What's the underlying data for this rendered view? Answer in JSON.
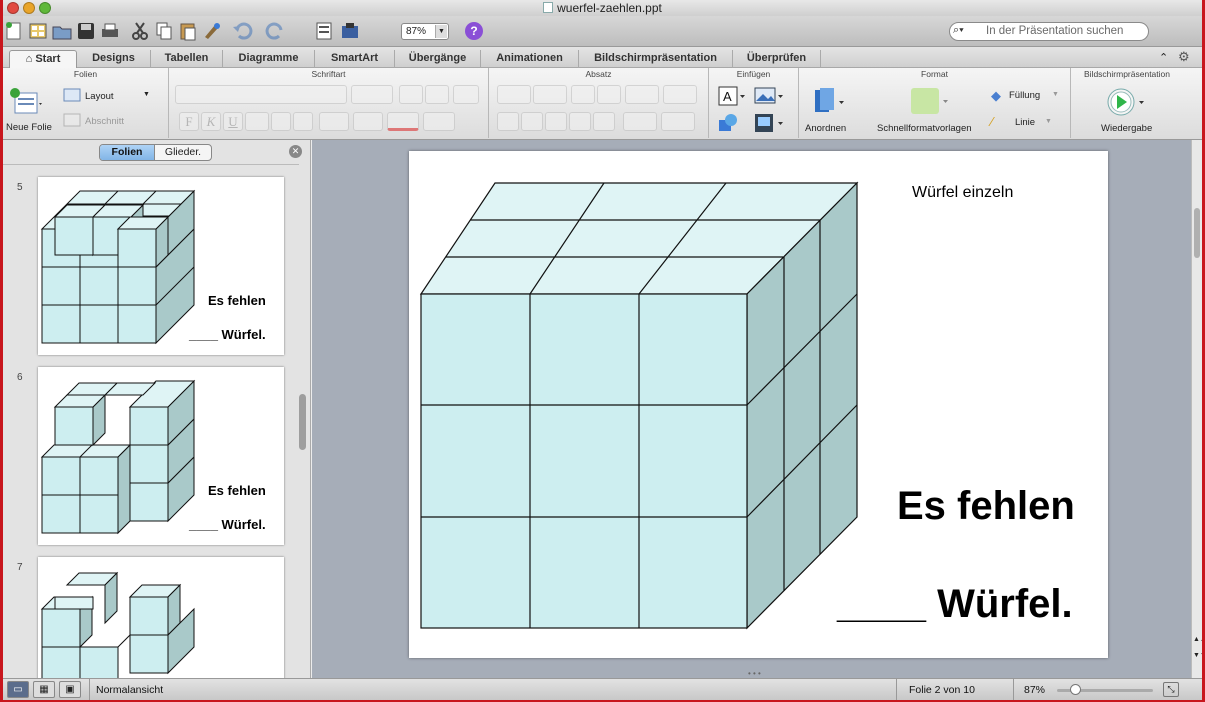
{
  "window": {
    "title": "wuerfel-zaehlen.ppt"
  },
  "toolbar": {
    "zoom": "87%",
    "help_label": "?"
  },
  "search": {
    "placeholder": "In der Präsentation suchen"
  },
  "tabs": [
    {
      "label": "Start",
      "icon": "home-icon"
    },
    {
      "label": "Designs"
    },
    {
      "label": "Tabellen"
    },
    {
      "label": "Diagramme"
    },
    {
      "label": "SmartArt"
    },
    {
      "label": "Übergänge"
    },
    {
      "label": "Animationen"
    },
    {
      "label": "Bildschirmpräsentation"
    },
    {
      "label": "Überprüfen"
    }
  ],
  "ribbon": {
    "folien": {
      "title": "Folien",
      "new_slide": "Neue Folie",
      "layout": "Layout",
      "section": "Abschnitt"
    },
    "schriftart": {
      "title": "Schriftart"
    },
    "absatz": {
      "title": "Absatz"
    },
    "einfuegen": {
      "title": "Einfügen"
    },
    "format": {
      "title": "Format",
      "arrange": "Anordnen",
      "quickstyles": "Schnellformatvorlagen",
      "fill": "Füllung",
      "line": "Linie"
    },
    "show": {
      "title": "Bildschirmpräsentation",
      "play": "Wiedergabe"
    }
  },
  "sidebar": {
    "tab_slides": "Folien",
    "tab_outline": "Glieder.",
    "thumbs": [
      {
        "num": "5",
        "line1": "Es fehlen",
        "line2": "____ Würfel."
      },
      {
        "num": "6",
        "line1": "Es fehlen",
        "line2": "____ Würfel."
      },
      {
        "num": "7",
        "line1": "",
        "line2": ""
      }
    ]
  },
  "slide": {
    "title": "Würfel einzeln",
    "line1": "Es fehlen",
    "line2": "____ Würfel."
  },
  "status": {
    "view": "Normalansicht",
    "slide_count": "Folie 2 von 10",
    "zoom": "87%"
  },
  "colors": {
    "cube_front": "#cdeef0",
    "cube_top": "#dff4f5",
    "cube_side": "#a9c9c9",
    "accent": "#c8161d"
  }
}
